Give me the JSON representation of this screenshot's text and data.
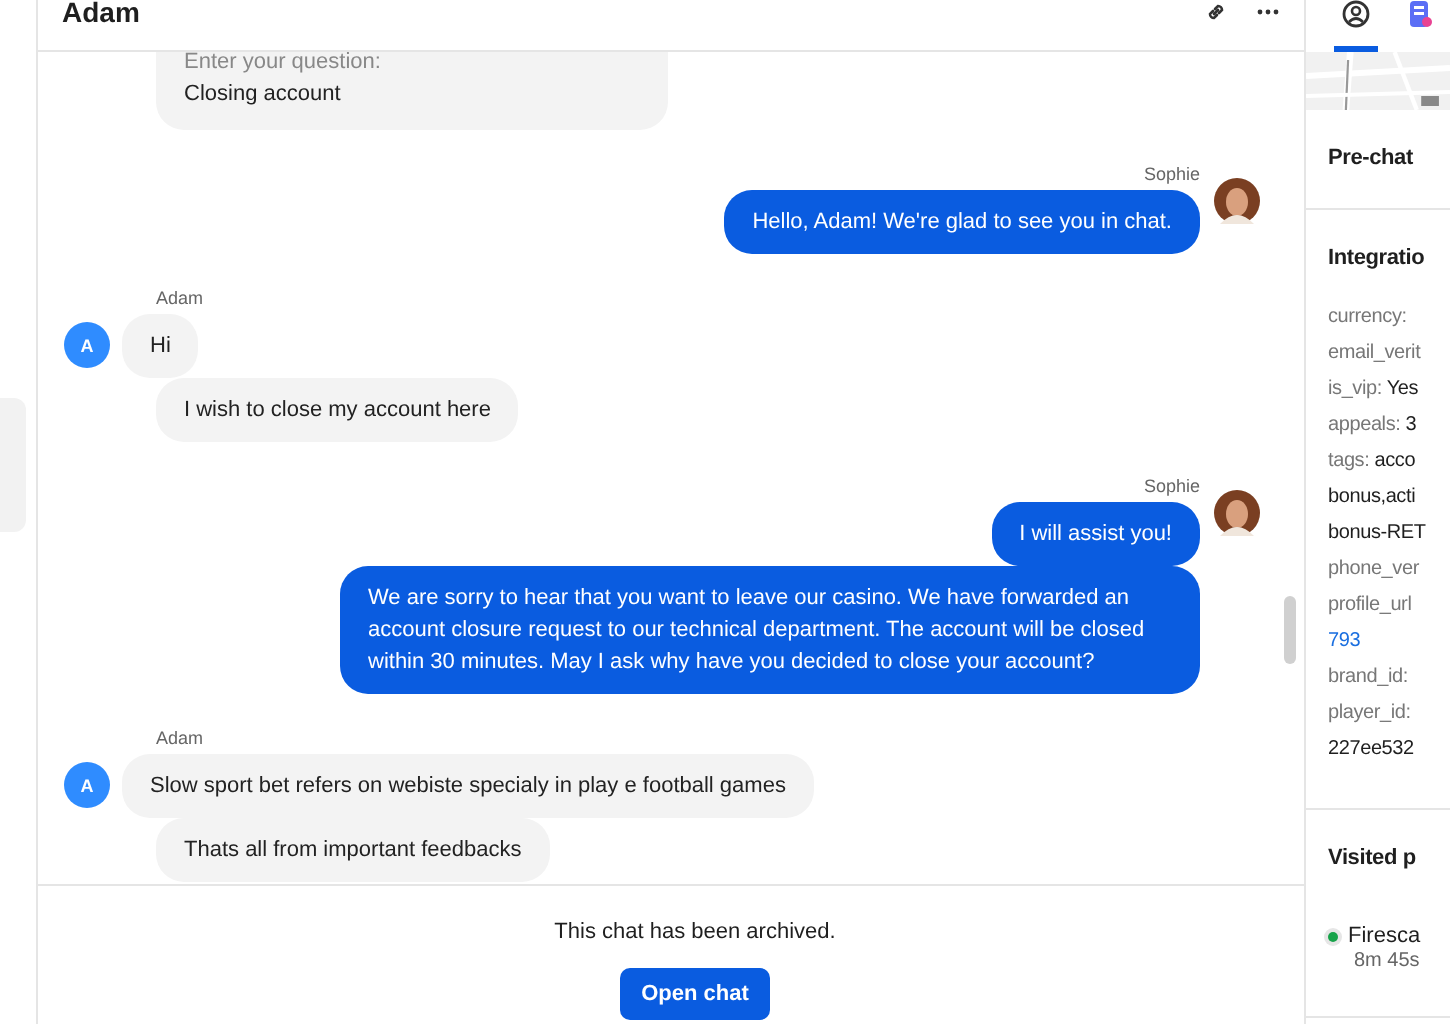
{
  "header": {
    "title": "Adam"
  },
  "groups": [
    {
      "kind": "visitor",
      "bubbles": [
        {
          "kind": "form",
          "label": "Enter your question:",
          "value": "Closing account"
        }
      ]
    },
    {
      "kind": "agent",
      "sender": "Sophie",
      "bubbles": [
        {
          "kind": "text",
          "text": "Hello, Adam! We're glad to see you in chat."
        }
      ]
    },
    {
      "kind": "visitor",
      "sender": "Adam",
      "avatar": "A",
      "bubbles": [
        {
          "kind": "text",
          "text": "Hi"
        },
        {
          "kind": "text",
          "text": "I wish to close my account here"
        }
      ]
    },
    {
      "kind": "agent",
      "sender": "Sophie",
      "bubbles": [
        {
          "kind": "text",
          "text": "I will assist you!"
        },
        {
          "kind": "text",
          "text": "We are sorry to hear that you want to leave our casino. We have forwarded an account closure request to our technical department. The account will be closed within 30 minutes. May I ask why have you decided to close your account?"
        }
      ]
    },
    {
      "kind": "visitor",
      "sender": "Adam",
      "avatar": "A",
      "bubbles": [
        {
          "kind": "text",
          "text": "Slow sport bet refers on webiste specialy in play e football games"
        },
        {
          "kind": "text",
          "text": "Thats all from important feedbacks"
        }
      ]
    }
  ],
  "footer": {
    "notice": "This chat has been archived.",
    "button": "Open chat"
  },
  "side_panel": {
    "tabs": [
      {
        "selected": true
      },
      {
        "selected": false
      }
    ],
    "sections": [
      {
        "title": "Pre-chat"
      },
      {
        "title": "Integratio",
        "rows": [
          {
            "kind": "pair",
            "key": "currency:",
            "value": ""
          },
          {
            "kind": "pair",
            "key": "email_verit",
            "value": ""
          },
          {
            "kind": "pair",
            "key": "is_vip:",
            "value": "Yes"
          },
          {
            "kind": "pair",
            "key": "appeals:",
            "value": "3"
          },
          {
            "kind": "pair",
            "key": "tags:",
            "value": "acco"
          },
          {
            "kind": "cont",
            "value": "bonus,acti"
          },
          {
            "kind": "cont",
            "value": "bonus-RET"
          },
          {
            "kind": "pair",
            "key": "phone_ver",
            "value": ""
          },
          {
            "kind": "pair",
            "key": "profile_url",
            "value": ""
          },
          {
            "kind": "link",
            "value": "793"
          },
          {
            "kind": "pair",
            "key": "brand_id:",
            "value": ""
          },
          {
            "kind": "pair",
            "key": "player_id:",
            "value": ""
          },
          {
            "kind": "cont",
            "value": "227ee532"
          }
        ]
      },
      {
        "title": "Visited p",
        "rows": [
          {
            "kind": "page",
            "value": "Firesca",
            "time": "8m 45s"
          }
        ]
      }
    ]
  }
}
